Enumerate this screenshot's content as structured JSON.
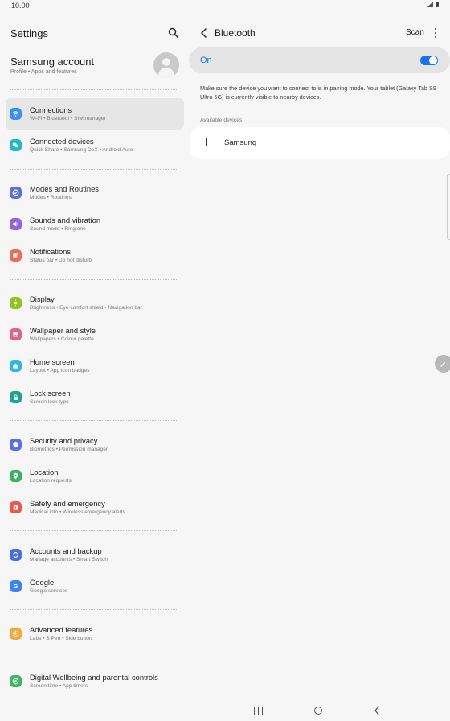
{
  "status": {
    "time": "10.00"
  },
  "left": {
    "title": "Settings",
    "account": {
      "name": "Samsung account",
      "sub": "Profile  •  Apps and features"
    },
    "items": [
      {
        "key": "connections",
        "title": "Connections",
        "sub": "Wi-Fi  •  Bluetooth  •  SIM manager",
        "color": "#3b8ff0",
        "icon": "wifi-icon",
        "active": true
      },
      {
        "key": "connected-devices",
        "title": "Connected devices",
        "sub": "Quick Share  •  Samsung DeX  •  Android Auto",
        "color": "#20b8c8",
        "icon": "devices-icon"
      },
      {
        "key": "modes",
        "title": "Modes and Routines",
        "sub": "Modes  •  Routines",
        "color": "#5a6fd8",
        "icon": "check-circle-icon"
      },
      {
        "key": "sounds",
        "title": "Sounds and vibration",
        "sub": "Sound mode  •  Ringtone",
        "color": "#8d67e0",
        "icon": "speaker-icon"
      },
      {
        "key": "notifications",
        "title": "Notifications",
        "sub": "Status bar  •  Do not disturb",
        "color": "#ef6b57",
        "icon": "bell-icon"
      },
      {
        "key": "display",
        "title": "Display",
        "sub": "Brightness  •  Eye comfort shield  •  Navigation bar",
        "color": "#8fc51c",
        "icon": "sun-icon"
      },
      {
        "key": "wallpaper",
        "title": "Wallpaper and style",
        "sub": "Wallpapers  •  Colour palette",
        "color": "#e0608f",
        "icon": "image-icon"
      },
      {
        "key": "home-screen",
        "title": "Home screen",
        "sub": "Layout  •  App icon badges",
        "color": "#2db7e2",
        "icon": "home-icon"
      },
      {
        "key": "lock-screen",
        "title": "Lock screen",
        "sub": "Screen lock type",
        "color": "#1aa68a",
        "icon": "lock-icon"
      },
      {
        "key": "security",
        "title": "Security and privacy",
        "sub": "Biometrics  •  Permission manager",
        "color": "#5b6fe0",
        "icon": "shield-icon"
      },
      {
        "key": "location",
        "title": "Location",
        "sub": "Location requests",
        "color": "#39b266",
        "icon": "location-pin-icon"
      },
      {
        "key": "safety",
        "title": "Safety and emergency",
        "sub": "Medical info  •  Wireless emergency alerts",
        "color": "#e9574f",
        "icon": "alert-icon"
      },
      {
        "key": "accounts",
        "title": "Accounts and backup",
        "sub": "Manage accounts  •  Smart Switch",
        "color": "#4a6fdc",
        "icon": "sync-icon"
      },
      {
        "key": "google",
        "title": "Google",
        "sub": "Google services",
        "color": "#3d82f0",
        "icon": "google-icon"
      },
      {
        "key": "advanced",
        "title": "Advanced features",
        "sub": "Labs  •  S Pen  •  Side button",
        "color": "#f2a83a",
        "icon": "gear-plus-icon"
      },
      {
        "key": "wellbeing",
        "title": "Digital Wellbeing and parental controls",
        "sub": "Screen time  •  App timers",
        "color": "#3fb65b",
        "icon": "wellbeing-icon"
      }
    ]
  },
  "right": {
    "title": "Bluetooth",
    "scan_label": "Scan",
    "toggle_label": "On",
    "toggle_on": true,
    "info": "Make sure the device you want to connect to is in pairing mode. Your tablet (Galaxy Tab S9 Ultra 5G) is currently visible to nearby devices.",
    "section_header": "Available devices",
    "devices": [
      {
        "name": "Samsung",
        "icon": "tablet-icon"
      }
    ]
  }
}
